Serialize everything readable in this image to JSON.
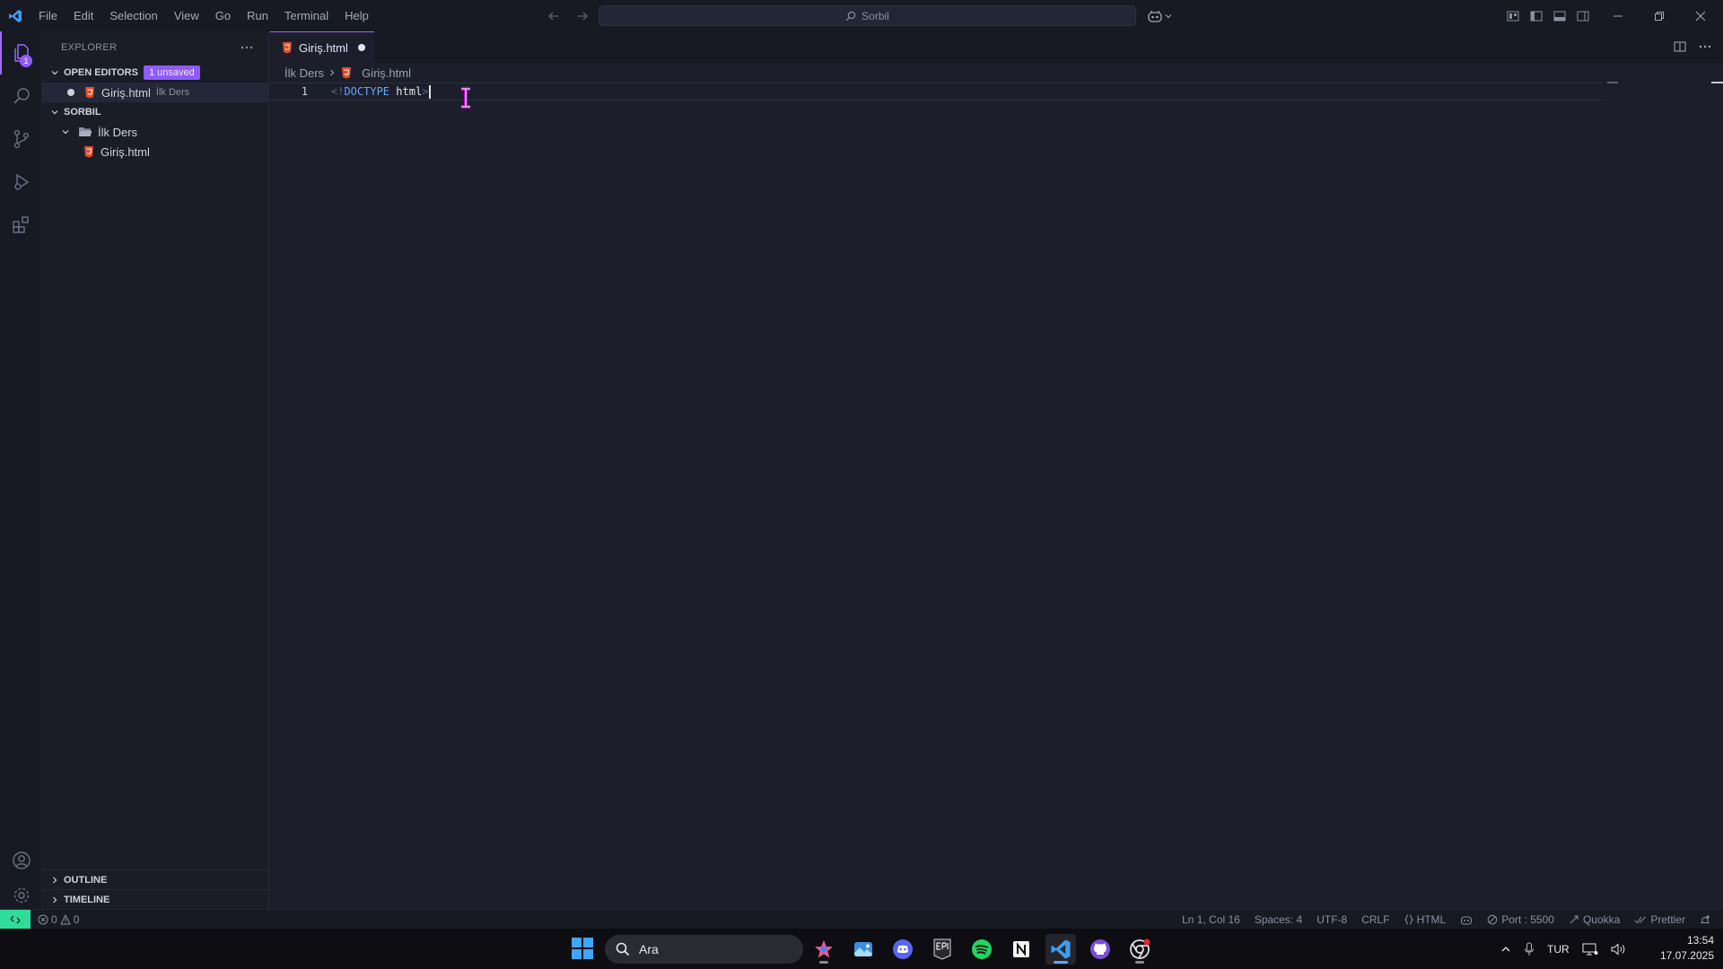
{
  "menu": [
    "File",
    "Edit",
    "Selection",
    "View",
    "Go",
    "Run",
    "Terminal",
    "Help"
  ],
  "command_center": {
    "text": "Sorbil"
  },
  "explorer": {
    "title": "EXPLORER",
    "open_editors": {
      "label": "OPEN EDITORS",
      "badge": "1 unsaved",
      "items": [
        {
          "name": "Giriş.html",
          "folder": "İlk Ders"
        }
      ]
    },
    "workspace": {
      "label": "SORBIL",
      "folder": "İlk Ders",
      "files": [
        "Giriş.html"
      ]
    },
    "outline_label": "OUTLINE",
    "timeline_label": "TIMELINE"
  },
  "activity": {
    "explorer_badge": "1"
  },
  "editor": {
    "tab": {
      "label": "Giriş.html"
    },
    "breadcrumbs": [
      "İlk Ders",
      "Giriş.html"
    ],
    "line_number": "1",
    "code": {
      "open": "<!",
      "keyword": "DOCTYPE",
      "name": "html",
      "close": ">"
    }
  },
  "status": {
    "errors": "0",
    "warnings": "0",
    "position": "Ln 1, Col 16",
    "spaces": "Spaces: 4",
    "encoding": "UTF-8",
    "eol": "CRLF",
    "language": "HTML",
    "port": "Port : 5500",
    "quokka": "Quokka",
    "prettier": "Prettier"
  },
  "taskbar": {
    "search_placeholder": "Ara",
    "language": "TUR",
    "time": "13:54",
    "date": "17.07.2025"
  },
  "colors": {
    "accent": "#a06cff",
    "remote": "#2fdc9b",
    "html_icon": "#e44d26"
  }
}
